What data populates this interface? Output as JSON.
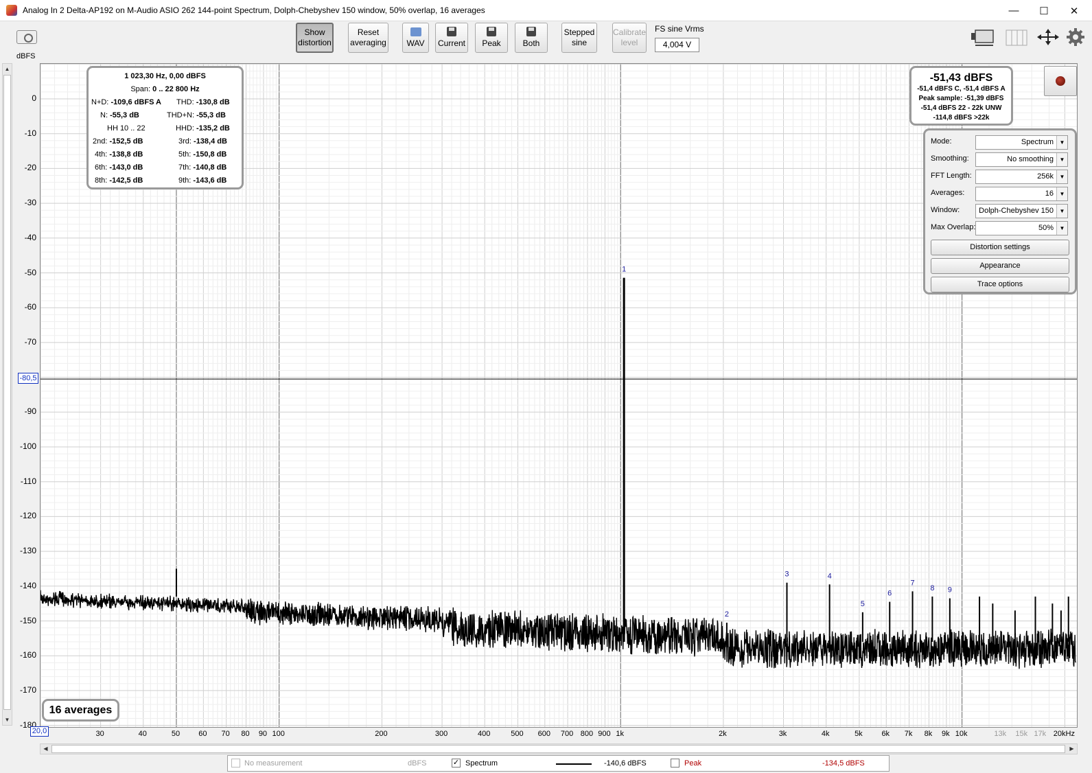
{
  "window": {
    "title": "Analog In 2 Delta-AP192 on M-Audio ASIO 262 144-point Spectrum, Dolph-Chebyshev 150 window, 50% overlap, 16 averages",
    "minimize": "—",
    "maximize": "☐",
    "close": "✕"
  },
  "toolbar": {
    "show_distortion": [
      "Show",
      "distortion"
    ],
    "reset_averaging": [
      "Reset",
      "averaging"
    ],
    "wav": "WAV",
    "current": "Current",
    "peak": "Peak",
    "both": "Both",
    "stepped_sine": [
      "Stepped",
      "sine"
    ],
    "calibrate_level": [
      "Calibrate",
      "level"
    ],
    "fs_label": "FS sine Vrms",
    "fs_value": "4,004 V"
  },
  "axis": {
    "y_unit": "dBFS",
    "y_ticks": [
      "0",
      "-10",
      "-20",
      "-30",
      "-40",
      "-50",
      "-60",
      "-70",
      "-80,5",
      "-90",
      "-100",
      "-110",
      "-120",
      "-130",
      "-140",
      "-150",
      "-160",
      "-170",
      "-180"
    ],
    "x_ticks": [
      "20,0",
      "30",
      "40",
      "50",
      "60",
      "70",
      "80",
      "90",
      "100",
      "200",
      "300",
      "400",
      "500",
      "600",
      "700",
      "800",
      "900",
      "1k",
      "2k",
      "3k",
      "4k",
      "5k",
      "6k",
      "7k",
      "8k",
      "9k",
      "10k",
      "13k",
      "15k",
      "17k",
      "20kHz"
    ],
    "y_cursor": "-80,5",
    "x_cursor": "20,0"
  },
  "distortion": {
    "freq_line": "1 023,30 Hz, 0,00 dBFS",
    "span_label": "Span:",
    "span_value": "0 .. 22 800 Hz",
    "nd_label": "N+D:",
    "nd_value": "-109,6 dBFS A",
    "thd_label": "THD:",
    "thd_value": "-130,8 dB",
    "n_label": "N:",
    "n_value": "-55,3 dB",
    "thdn_label": "THD+N:",
    "thdn_value": "-55,3 dB",
    "hh_label": "HH 10 .. 22",
    "hhd_label": "HHD:",
    "hhd_value": "-135,2 dB",
    "h2_label": "2nd:",
    "h2_value": "-152,5 dB",
    "h3_label": "3rd:",
    "h3_value": "-138,4 dB",
    "h4_label": "4th:",
    "h4_value": "-138,8 dB",
    "h5_label": "5th:",
    "h5_value": "-150,8 dB",
    "h6_label": "6th:",
    "h6_value": "-143,0 dB",
    "h7_label": "7th:",
    "h7_value": "-140,8 dB",
    "h8_label": "8th:",
    "h8_value": "-142,5 dB",
    "h9_label": "9th:",
    "h9_value": "-143,6 dB"
  },
  "level": {
    "main": "-51,43 dBFS",
    "line1": "-51,4 dBFS C, -51,4 dBFS A",
    "line2": "Peak sample: -51,39 dBFS",
    "line3": "-51,4 dBFS 22 - 22k UNW",
    "line4": "-114,8 dBFS >22k"
  },
  "settings": {
    "mode_label": "Mode:",
    "mode_value": "Spectrum",
    "smoothing_label": "Smoothing:",
    "smoothing_value": "No  smoothing",
    "fft_label": "FFT Length:",
    "fft_value": "256k",
    "averages_label": "Averages:",
    "averages_value": "16",
    "window_label": "Window:",
    "window_value": "Dolph-Chebyshev 150",
    "overlap_label": "Max Overlap:",
    "overlap_value": "50%",
    "distortion_settings": "Distortion settings",
    "appearance": "Appearance",
    "trace_options": "Trace options"
  },
  "averages_badge": "16 averages",
  "legend": {
    "no_measurement": "No measurement",
    "no_measurement_unit": "dBFS",
    "spectrum": "Spectrum",
    "spectrum_value": "-140,6 dBFS",
    "peak": "Peak",
    "peak_value": "-134,5 dBFS",
    "peak_color": "#b00000"
  },
  "spectrum": {
    "trace_color": "#000000",
    "marker_color": "#1a1a9a",
    "fundamental_hz": 1023.3,
    "fundamental_dbfs": -51.4,
    "markers": [
      {
        "label": "1",
        "hz": 1023.3,
        "db": -51.4
      },
      {
        "label": "2",
        "hz": 2046.6,
        "db": -150.5
      },
      {
        "label": "3",
        "hz": 3069.9,
        "db": -139
      },
      {
        "label": "4",
        "hz": 4093.2,
        "db": -139.5
      },
      {
        "label": "5",
        "hz": 5116.5,
        "db": -147.5
      },
      {
        "label": "6",
        "hz": 6139.8,
        "db": -144.5
      },
      {
        "label": "7",
        "hz": 7163.1,
        "db": -141.5
      },
      {
        "label": "8",
        "hz": 8186.4,
        "db": -143
      },
      {
        "label": "9",
        "hz": 9209.7,
        "db": -143.5
      }
    ]
  }
}
